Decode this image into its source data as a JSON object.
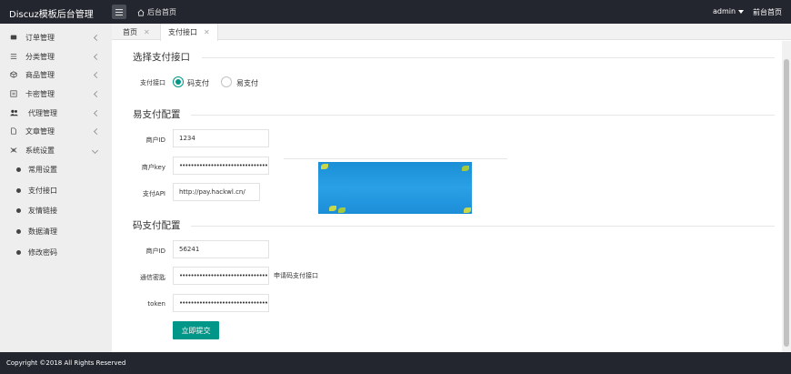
{
  "header": {
    "logo": "Discuz模板后台管理",
    "home_link": "后台首页",
    "user": "admin",
    "front_link": "前台首页"
  },
  "sidebar": {
    "items": [
      {
        "label": "订单管理",
        "icon": "monitor-icon"
      },
      {
        "label": "分类管理",
        "icon": "list-icon"
      },
      {
        "label": "商品管理",
        "icon": "box-icon"
      },
      {
        "label": "卡密管理",
        "icon": "card-icon"
      },
      {
        "label": "代理管理",
        "icon": "users-icon"
      },
      {
        "label": "文章管理",
        "icon": "document-icon"
      },
      {
        "label": "系统设置",
        "icon": "settings-icon"
      }
    ],
    "subitems": [
      "常用设置",
      "支付接口",
      "友情链接",
      "数据清理",
      "修改密码"
    ]
  },
  "tabs": [
    {
      "label": "首页",
      "close": "✕"
    },
    {
      "label": "支付接口",
      "close": "✕"
    }
  ],
  "section_select": {
    "title": "选择支付接口",
    "label": "支付接口",
    "options": [
      "码支付",
      "易支付"
    ],
    "selected": "码支付"
  },
  "section_epay": {
    "title": "易支付配置",
    "fields": [
      {
        "label": "商户ID",
        "value": "1234"
      },
      {
        "label": "商户key",
        "value": "••••••••••••••••••••••••••••••••"
      },
      {
        "label": "支付API",
        "value": "http://pay.hackwl.cn/"
      }
    ]
  },
  "section_codepay": {
    "title": "码支付配置",
    "fields": [
      {
        "label": "商户ID",
        "value": "56241"
      },
      {
        "label": "通信密匙",
        "value": "••••••••••••••••••••••••••••••••"
      },
      {
        "label": "token",
        "value": "••••••••••••••••••••••••••••••••"
      }
    ],
    "hint": "申请码支付接口",
    "submit": "立即提交"
  },
  "footer": {
    "copyright": "Copyright ©2018 All Rights Reserved"
  },
  "colors": {
    "primary": "#009688",
    "header_bg": "#23262e",
    "sidebar_bg": "#eeeeee"
  }
}
